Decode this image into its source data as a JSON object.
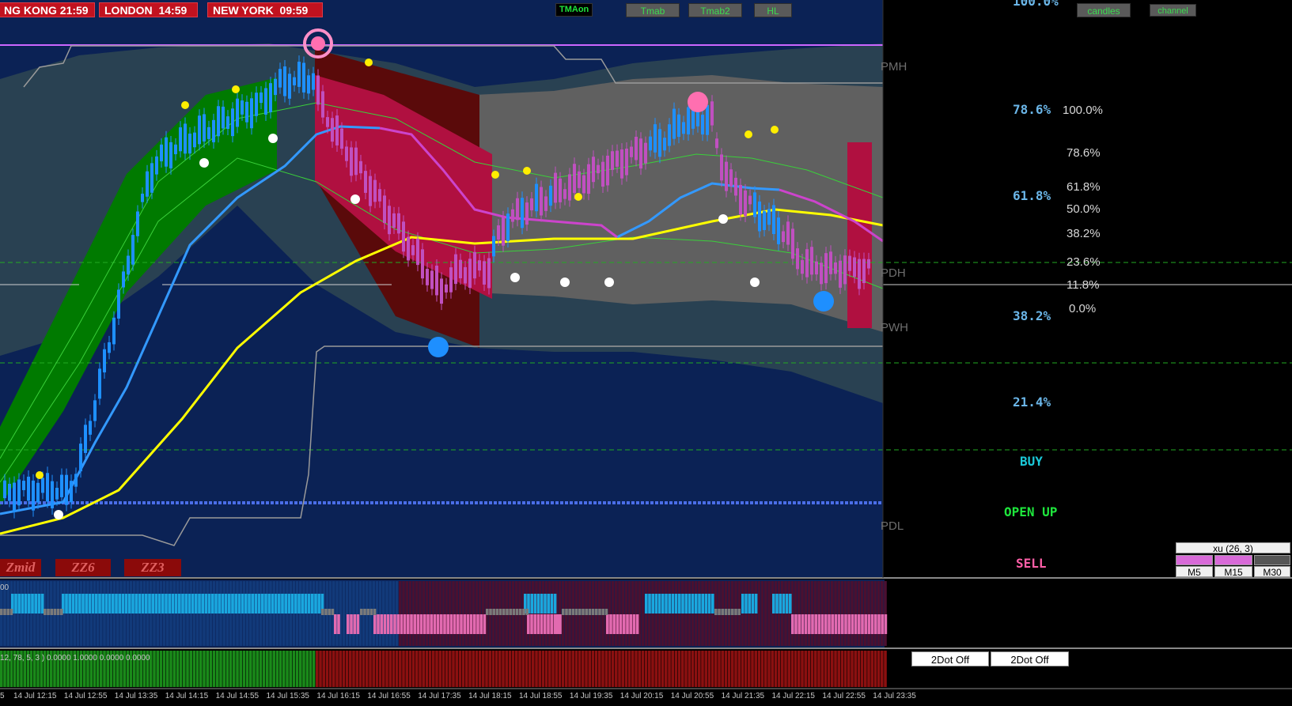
{
  "clocks": [
    {
      "city": "NG KONG",
      "time": "21:59"
    },
    {
      "city": "LONDON",
      "time": "14:59"
    },
    {
      "city": "NEW YORK",
      "time": "09:59"
    }
  ],
  "toolbar": {
    "tmaon_label": "TMAon",
    "tmab_label": "Tmab",
    "tmab2_label": "Tmab2",
    "hl_label": "HL",
    "candles_label": "candles",
    "channel_label": "channel"
  },
  "levels": {
    "pmh": "PMH",
    "pdh": "PDH",
    "pwh": "PWH",
    "pdl": "PDL"
  },
  "fib_left": {
    "f786": "78.6%",
    "f618": "61.8%",
    "f382": "38.2%",
    "f214": "21.4%",
    "top_cut": "100.0%"
  },
  "fib_right": {
    "p100": "100.0%",
    "p786": "78.6%",
    "p618": "61.8%",
    "p500": "50.0%",
    "p382": "38.2%",
    "p236": "23.6%",
    "p118": "11.8%",
    "p0": "0.0%"
  },
  "signals": {
    "buy": "BUY",
    "open": "OPEN UP",
    "sell": "SELL"
  },
  "zigzag": {
    "zmid": "Zmid",
    "zz6": "ZZ6",
    "zz3": "ZZ3"
  },
  "timeframe_panel": {
    "title": "xu (26, 3)",
    "labels": [
      "M5",
      "M15",
      "M30"
    ],
    "states": [
      "pink",
      "pink",
      "gray"
    ]
  },
  "indicator": {
    "top_label": "00",
    "bottom_label": "12, 78, 5, 3 ) 0.0000 1.0000 0.0000 0.0000"
  },
  "dot_buttons": [
    "2Dot Off",
    "2Dot Off"
  ],
  "x_axis": {
    "edge_label": "5",
    "labels": [
      "14 Jul 12:15",
      "14 Jul 12:55",
      "14 Jul 13:35",
      "14 Jul 14:15",
      "14 Jul 14:55",
      "14 Jul 15:35",
      "14 Jul 16:15",
      "14 Jul 16:55",
      "14 Jul 17:35",
      "14 Jul 18:15",
      "14 Jul 18:55",
      "14 Jul 19:35",
      "14 Jul 20:15",
      "14 Jul 20:55",
      "14 Jul 21:35",
      "14 Jul 22:15",
      "14 Jul 22:55",
      "14 Jul 23:35"
    ]
  },
  "colors": {
    "chart_bg": "#0b2255",
    "bull": "#1e90ff",
    "bear": "#c050c0",
    "uptrend_band": "#007a00",
    "downtrend_band": "#b01040",
    "neutral_band": "#606060",
    "ma_yellow": "#ffff00",
    "ma_blue": "#3399ff",
    "ma_magenta": "#cc44cc",
    "buy": "#1bc8d8",
    "open": "#1ee63c",
    "sell": "#ff5fa8"
  }
}
